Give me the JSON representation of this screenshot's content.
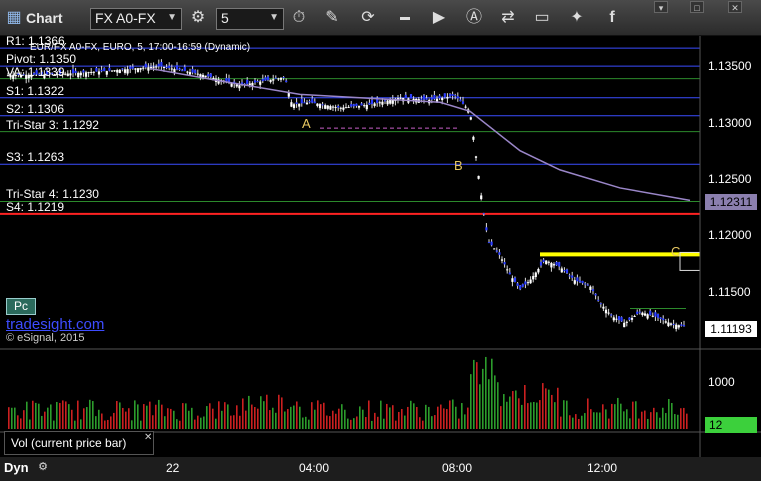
{
  "toolbar": {
    "app_title": "Chart",
    "symbol": "FX A0-FX",
    "interval": "5"
  },
  "chart_data": {
    "type": "candlestick",
    "symbol_line": "EUR/FX A0-FX, EURO, 5, 17:00-16:59 (Dynamic)",
    "ylim": [
      1.11,
      1.1375
    ],
    "y_ticks": [
      "1.13500",
      "1.13000",
      "1.12500",
      "1.12000",
      "1.11500"
    ],
    "x_ticks": [
      "22",
      "04:00",
      "08:00",
      "12:00"
    ],
    "last_price": "1.11193",
    "vwap_price": "1.12311",
    "levels": [
      {
        "label": "R1: 1.1366",
        "value": 1.1366,
        "color": "#3a4dff"
      },
      {
        "label": "Pivot: 1.1350",
        "value": 1.135,
        "color": "#3a4dff"
      },
      {
        "label": "VA: 1.1339",
        "value": 1.1339,
        "color": "#2c8a2c"
      },
      {
        "label": "S1: 1.1322",
        "value": 1.1322,
        "color": "#3a4dff"
      },
      {
        "label": "S2: 1.1306",
        "value": 1.1306,
        "color": "#3a4dff"
      },
      {
        "label": "Tri-Star 3: 1.1292",
        "value": 1.1292,
        "color": "#2c8a2c"
      },
      {
        "label": "S3: 1.1263",
        "value": 1.1263,
        "color": "#3a4dff"
      },
      {
        "label": "Tri-Star 4: 1.1230",
        "value": 1.123,
        "color": "#2c8a2c"
      },
      {
        "label": "S4: 1.1219",
        "value": 1.1219,
        "color": "#ff2222"
      }
    ],
    "annotations": [
      "A",
      "B",
      "C"
    ],
    "volume_label": "1000",
    "volume_value": "12"
  },
  "branding": {
    "badge": "Pc",
    "site": "tradesight.com",
    "copyright": "© eSignal, 2015"
  },
  "volume_tab": "Vol (current price bar)",
  "bottom": {
    "mode": "Dyn"
  }
}
